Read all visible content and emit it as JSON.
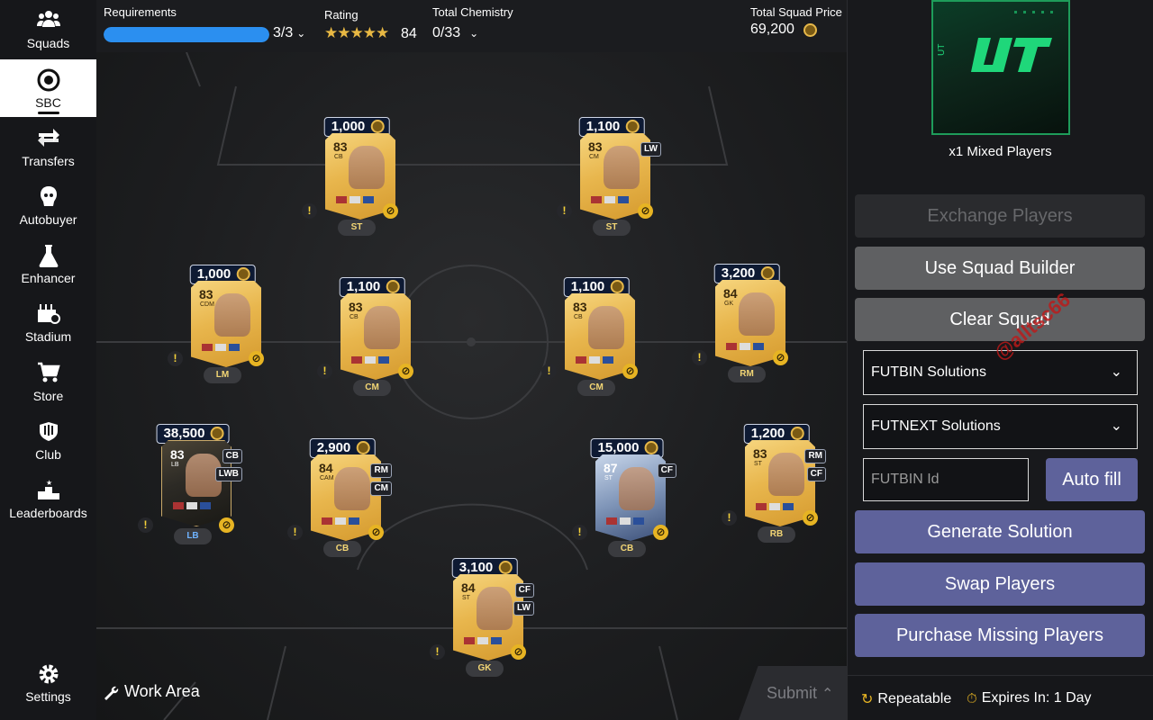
{
  "sidebar": {
    "items": [
      {
        "label": "Squads",
        "icon": "users-icon"
      },
      {
        "label": "SBC",
        "icon": "sbc-icon"
      },
      {
        "label": "Transfers",
        "icon": "transfer-arrows-icon"
      },
      {
        "label": "Autobuyer",
        "icon": "autobuyer-icon"
      },
      {
        "label": "Enhancer",
        "icon": "flask-icon"
      },
      {
        "label": "Stadium",
        "icon": "stadium-icon"
      },
      {
        "label": "Store",
        "icon": "cart-icon"
      },
      {
        "label": "Club",
        "icon": "club-icon"
      },
      {
        "label": "Leaderboards",
        "icon": "podium-icon"
      }
    ],
    "settings_label": "Settings"
  },
  "topbar": {
    "requirements_label": "Requirements",
    "requirements_value": "3/3",
    "requirements_progress": 1.0,
    "rating_label": "Rating",
    "rating_stars": "★★★★★",
    "rating_value": "84",
    "chemistry_label": "Total Chemistry",
    "chemistry_value": "0/33",
    "price_label": "Total Squad Price",
    "price_value": "69,200"
  },
  "players": [
    {
      "price": "1,000",
      "rating": "83",
      "pos": "CB",
      "slot": "ST",
      "alts": [],
      "type": "gold"
    },
    {
      "price": "1,100",
      "rating": "83",
      "pos": "CM",
      "slot": "ST",
      "alts": [
        "LW"
      ],
      "type": "gold"
    },
    {
      "price": "1,000",
      "rating": "83",
      "pos": "CDM",
      "slot": "LM",
      "alts": [],
      "type": "gold"
    },
    {
      "price": "1,100",
      "rating": "83",
      "pos": "CB",
      "slot": "CM",
      "alts": [],
      "type": "gold"
    },
    {
      "price": "1,100",
      "rating": "83",
      "pos": "CB",
      "slot": "CM",
      "alts": [],
      "type": "gold"
    },
    {
      "price": "3,200",
      "rating": "84",
      "pos": "GK",
      "slot": "RM",
      "alts": [],
      "type": "gold"
    },
    {
      "price": "38,500",
      "rating": "83",
      "pos": "LB",
      "slot": "LB",
      "alts": [
        "CB",
        "LWB"
      ],
      "type": "dark"
    },
    {
      "price": "2,900",
      "rating": "84",
      "pos": "CAM",
      "slot": "CB",
      "alts": [
        "RM",
        "CM"
      ],
      "type": "gold"
    },
    {
      "price": "15,000",
      "rating": "87",
      "pos": "ST",
      "slot": "CB",
      "alts": [
        "CF"
      ],
      "type": "blue"
    },
    {
      "price": "1,200",
      "rating": "83",
      "pos": "ST",
      "slot": "RB",
      "alts": [
        "RM",
        "CF"
      ],
      "type": "gold"
    },
    {
      "price": "3,100",
      "rating": "84",
      "pos": "ST",
      "slot": "GK",
      "alts": [
        "CF",
        "LW"
      ],
      "type": "gold"
    }
  ],
  "work_area_label": "Work Area",
  "submit_label": "Submit",
  "panel": {
    "pack_caption": "x1 Mixed Players",
    "exchange_label": "Exchange Players",
    "squad_builder_label": "Use Squad Builder",
    "clear_label": "Clear Squad",
    "futbin_select": "FUTBIN Solutions",
    "futnext_select": "FUTNEXT Solutions",
    "futbin_id_placeholder": "FUTBIN Id",
    "autofill_label": "Auto fill",
    "generate_label": "Generate Solution",
    "swap_label": "Swap Players",
    "purchase_label": "Purchase Missing Players",
    "repeatable_label": "Repeatable",
    "expires_label": "Expires In: 1 Day"
  },
  "watermark": "@alltsc66"
}
